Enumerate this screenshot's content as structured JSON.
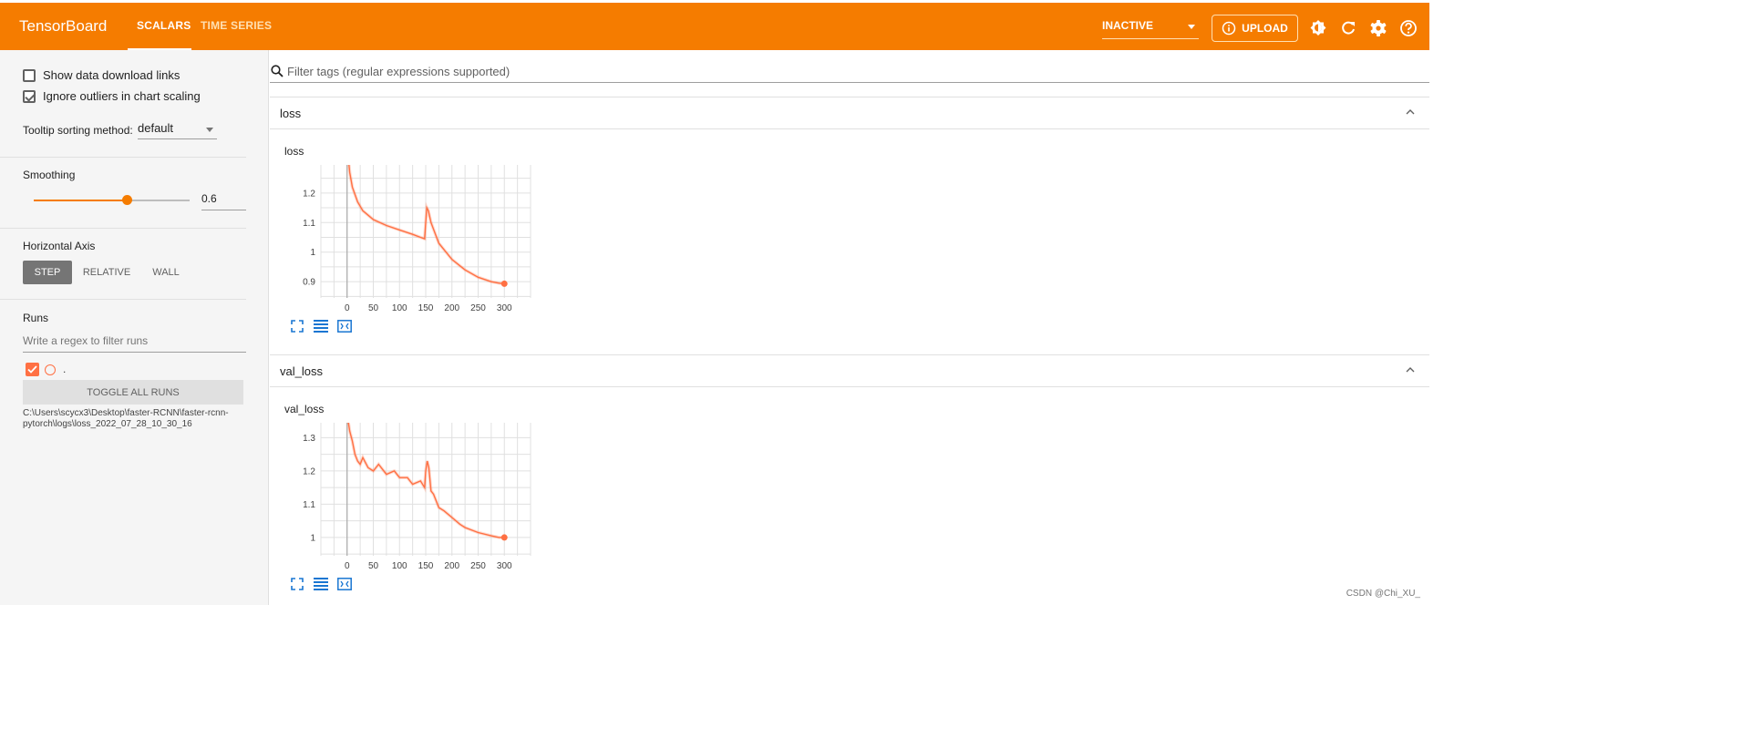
{
  "header": {
    "brand": "TensorBoard",
    "tabs": [
      {
        "label": "SCALARS",
        "active": true
      },
      {
        "label": "TIME SERIES",
        "active": false
      }
    ],
    "run_status": "INACTIVE",
    "upload_label": "UPLOAD",
    "icons": [
      "theme-icon",
      "refresh-icon",
      "settings-icon",
      "help-icon"
    ],
    "accent": "#f57c00"
  },
  "sidebar": {
    "show_download_links": {
      "label": "Show data download links",
      "checked": false
    },
    "ignore_outliers": {
      "label": "Ignore outliers in chart scaling",
      "checked": true
    },
    "tooltip_sorting": {
      "label": "Tooltip sorting method:",
      "value": "default"
    },
    "smoothing": {
      "label": "Smoothing",
      "value": "0.6",
      "fraction": 0.6
    },
    "horizontal_axis": {
      "label": "Horizontal Axis",
      "options": [
        "STEP",
        "RELATIVE",
        "WALL"
      ],
      "selected": "STEP"
    },
    "runs": {
      "label": "Runs",
      "filter_placeholder": "Write a regex to filter runs",
      "run_name": ".",
      "run_checked": true,
      "toggle_all": "TOGGLE ALL RUNS",
      "path": "C:\\Users\\scycx3\\Desktop\\faster-RCNN\\faster-rcnn-pytorch\\logs\\loss_2022_07_28_10_30_16"
    }
  },
  "main": {
    "filter_placeholder": "Filter tags (regular expressions supported)",
    "cards": [
      {
        "group": "loss",
        "chart_title": "loss"
      },
      {
        "group": "val_loss",
        "chart_title": "val_loss"
      }
    ]
  },
  "watermark": "CSDN @Chi_XU_",
  "chart_data": [
    {
      "type": "line",
      "title": "loss",
      "x_ticks": [
        0,
        50,
        100,
        150,
        200,
        250,
        300
      ],
      "y_ticks": [
        0.9,
        1,
        1.1,
        1.2
      ],
      "xlim": [
        -50,
        350
      ],
      "ylim": [
        0.845,
        1.295
      ],
      "series": [
        {
          "x": [
            0,
            5,
            10,
            20,
            30,
            40,
            50,
            75,
            100,
            125,
            140,
            148,
            150,
            152,
            155,
            160,
            175,
            200,
            225,
            250,
            275,
            290,
            300
          ],
          "y": [
            1.36,
            1.27,
            1.22,
            1.17,
            1.14,
            1.125,
            1.11,
            1.09,
            1.075,
            1.06,
            1.05,
            1.045,
            1.1,
            1.15,
            1.14,
            1.1,
            1.03,
            0.975,
            0.94,
            0.915,
            0.9,
            0.895,
            0.893
          ]
        }
      ],
      "color": "#ff7043"
    },
    {
      "type": "line",
      "title": "val_loss",
      "x_ticks": [
        0,
        50,
        100,
        150,
        200,
        250,
        300
      ],
      "y_ticks": [
        1,
        1.1,
        1.2,
        1.3
      ],
      "xlim": [
        -50,
        350
      ],
      "ylim": [
        0.945,
        1.345
      ],
      "series": [
        {
          "x": [
            0,
            5,
            10,
            15,
            20,
            25,
            30,
            40,
            50,
            60,
            75,
            90,
            100,
            115,
            125,
            140,
            148,
            150,
            153,
            156,
            160,
            165,
            175,
            185,
            200,
            215,
            225,
            250,
            275,
            290,
            300
          ],
          "y": [
            1.37,
            1.32,
            1.29,
            1.25,
            1.23,
            1.22,
            1.24,
            1.21,
            1.2,
            1.22,
            1.19,
            1.2,
            1.18,
            1.18,
            1.16,
            1.17,
            1.15,
            1.2,
            1.23,
            1.21,
            1.14,
            1.13,
            1.09,
            1.08,
            1.06,
            1.04,
            1.03,
            1.015,
            1.005,
            1.0,
            1.0
          ]
        }
      ],
      "color": "#ff7043"
    }
  ]
}
